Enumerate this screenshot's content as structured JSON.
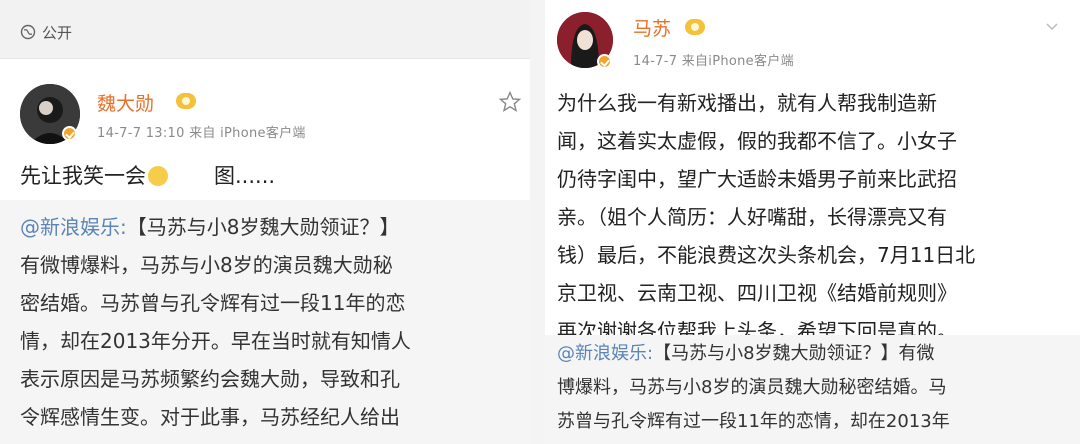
{
  "left_post": {
    "visibility_label": "公开",
    "username": "魏大勋",
    "meta": "14-7-7 13:10 来自 iPhone客户端",
    "body_before_emoji": "先让我笑一会",
    "body_after_emoji": "图......",
    "repost": {
      "mention": "@新浪娱乐:",
      "lines": [
        "【马苏与小8岁魏大勋领证？】",
        "有微博爆料，马苏与小8岁的演员魏大勋秘",
        "密结婚。马苏曾与孔令辉有过一段11年的恋",
        "情，却在2013年分开。早在当时就有知情人",
        "表示原因是马苏频繁约会魏大勋，导致和孔",
        "令辉感情生变。对于此事，马苏经纪人给出"
      ]
    }
  },
  "right_post": {
    "username": "马苏",
    "meta": "14-7-7 来自iPhone客户端",
    "body_lines": [
      "为什么我一有新戏播出，就有人帮我制造新",
      "闻，这着实太虚假，假的我都不信了。小女子",
      "仍待字闺中，望广大适龄未婚男子前来比武招",
      "亲。（姐个人简历：人好嘴甜，长得漂亮又有",
      "钱）最后，不能浪费这次头条机会，7月11日北",
      "京卫视、云南卫视、四川卫视《结婚前规则》",
      "再次谢谢各位帮我上头条，希望下回是真的。"
    ],
    "repost": {
      "mention": "@新浪娱乐:",
      "lines": [
        "【马苏与小8岁魏大勋领证？】有微",
        "博爆料，马苏与小8岁的演员魏大勋秘密结婚。马",
        "苏曾与孔令辉有过一段11年的恋情，却在2013年"
      ]
    }
  },
  "colors": {
    "username": "#e8712a",
    "mention": "#5b85b6",
    "repost_bg": "#f5f5f5"
  }
}
